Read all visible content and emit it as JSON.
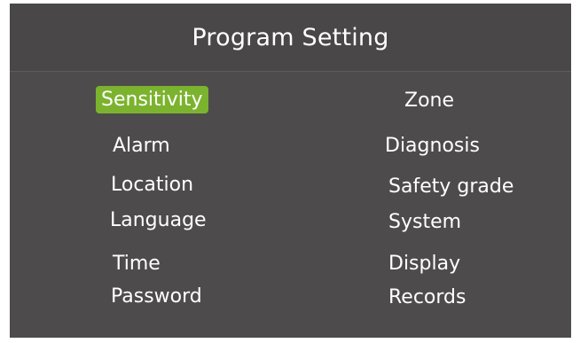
{
  "header": {
    "title": "Program Setting"
  },
  "menu": {
    "left": [
      {
        "id": "sensitivity",
        "label": "Sensitivity",
        "selected": true
      },
      {
        "id": "alarm",
        "label": "Alarm"
      },
      {
        "id": "location",
        "label": "Location"
      },
      {
        "id": "language",
        "label": "Language"
      },
      {
        "id": "time",
        "label": "Time"
      },
      {
        "id": "password",
        "label": "Password"
      }
    ],
    "right": [
      {
        "id": "zone",
        "label": "Zone"
      },
      {
        "id": "diagnosis",
        "label": "Diagnosis"
      },
      {
        "id": "safety-grade",
        "label": "Safety grade"
      },
      {
        "id": "system",
        "label": "System"
      },
      {
        "id": "display",
        "label": "Display"
      },
      {
        "id": "records",
        "label": "Records"
      }
    ]
  },
  "colors": {
    "panel_bg": "#4e4b4c",
    "header_bg": "#4a4748",
    "selection": "#7cb32e",
    "text": "#ffffff"
  }
}
